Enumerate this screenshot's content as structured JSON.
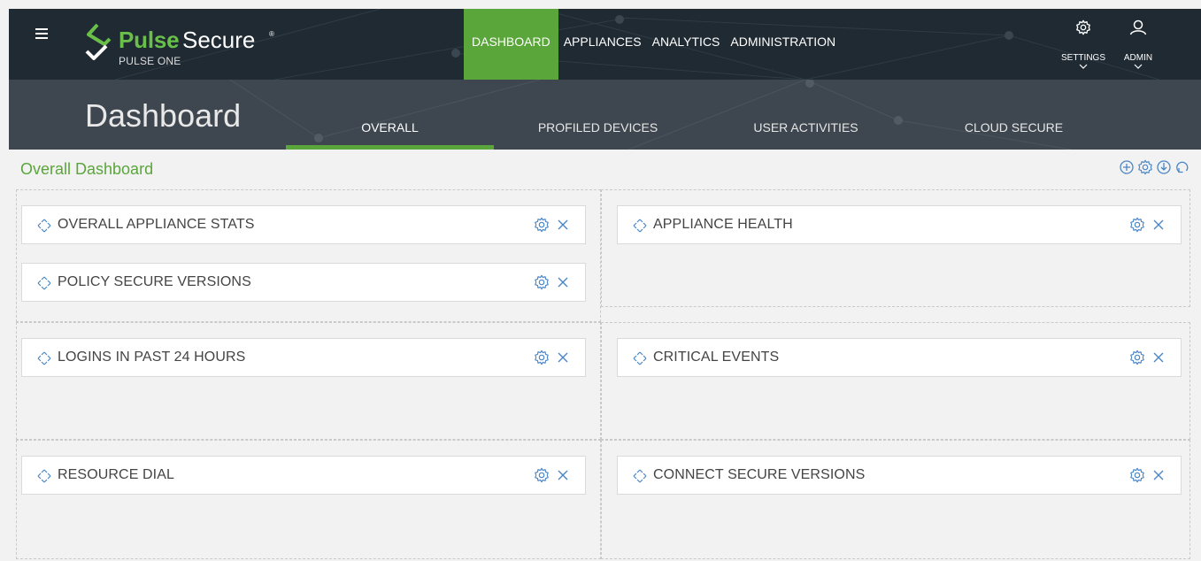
{
  "brand": {
    "name_accent": "Pulse",
    "name_rest": "Secure",
    "trademark": "®",
    "product": "PULSE ONE",
    "accent_color": "#5aa63a",
    "nav_bg_color": "#1f2a33",
    "subnav_bg_color": "#3e474f"
  },
  "main_nav": [
    {
      "label": "DASHBOARD",
      "active": true
    },
    {
      "label": "APPLIANCES",
      "active": false
    },
    {
      "label": "ANALYTICS",
      "active": false
    },
    {
      "label": "ADMINISTRATION",
      "active": false
    }
  ],
  "top_right": {
    "settings": {
      "label": "SETTINGS",
      "icon": "gear-icon"
    },
    "admin": {
      "label": "ADMIN",
      "icon": "user-icon"
    }
  },
  "page_title": "Dashboard",
  "sub_tabs": [
    {
      "label": "OVERALL",
      "active": true
    },
    {
      "label": "PROFILED DEVICES",
      "active": false
    },
    {
      "label": "USER ACTIVITIES",
      "active": false
    },
    {
      "label": "CLOUD SECURE",
      "active": false
    }
  ],
  "dashboard": {
    "title": "Overall Dashboard",
    "actions": [
      "add-widget-icon",
      "dashboard-settings-icon",
      "download-icon",
      "refresh-icon"
    ]
  },
  "widgets": [
    {
      "title": "OVERALL APPLIANCE STATS"
    },
    {
      "title": "POLICY SECURE VERSIONS"
    },
    {
      "title": "APPLIANCE HEALTH"
    },
    {
      "title": "LOGINS IN PAST 24 HOURS"
    },
    {
      "title": "CRITICAL EVENTS"
    },
    {
      "title": "RESOURCE DIAL"
    },
    {
      "title": "CONNECT SECURE VERSIONS"
    }
  ]
}
